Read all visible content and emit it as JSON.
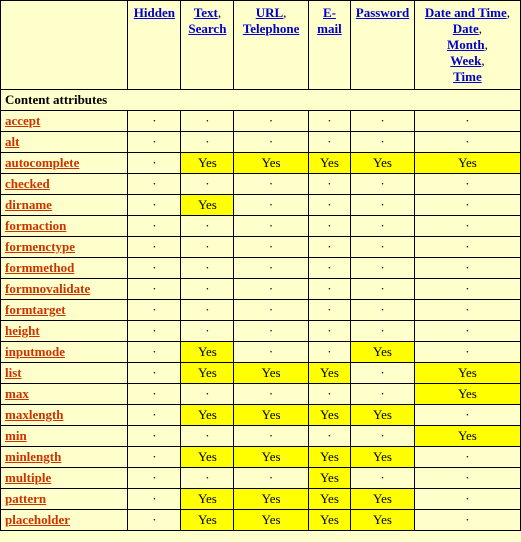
{
  "headers": {
    "hidden": [
      "Hidden"
    ],
    "text": [
      "Text",
      "Search"
    ],
    "url": [
      "URL",
      "Telephone"
    ],
    "email": [
      "E-mail"
    ],
    "password": [
      "Password"
    ],
    "date": [
      "Date and Time",
      "Date",
      "Month",
      "Week",
      "Time"
    ]
  },
  "section": "Content attributes",
  "yes": "Yes",
  "dot": "·",
  "rows": [
    {
      "attr": "accept",
      "cells": [
        "dot",
        "dot",
        "dot",
        "dot",
        "dot",
        "dot"
      ]
    },
    {
      "attr": "alt",
      "cells": [
        "dot",
        "dot",
        "dot",
        "dot",
        "dot",
        "dot"
      ]
    },
    {
      "attr": "autocomplete",
      "cells": [
        "dot",
        "yes",
        "yes",
        "yes",
        "yes",
        "yes"
      ]
    },
    {
      "attr": "checked",
      "cells": [
        "dot",
        "dot",
        "dot",
        "dot",
        "dot",
        "dot"
      ]
    },
    {
      "attr": "dirname",
      "cells": [
        "dot",
        "yes",
        "dot",
        "dot",
        "dot",
        "dot"
      ]
    },
    {
      "attr": "formaction",
      "cells": [
        "dot",
        "dot",
        "dot",
        "dot",
        "dot",
        "dot"
      ]
    },
    {
      "attr": "formenctype",
      "cells": [
        "dot",
        "dot",
        "dot",
        "dot",
        "dot",
        "dot"
      ]
    },
    {
      "attr": "formmethod",
      "cells": [
        "dot",
        "dot",
        "dot",
        "dot",
        "dot",
        "dot"
      ]
    },
    {
      "attr": "formnovalidate",
      "cells": [
        "dot",
        "dot",
        "dot",
        "dot",
        "dot",
        "dot"
      ]
    },
    {
      "attr": "formtarget",
      "cells": [
        "dot",
        "dot",
        "dot",
        "dot",
        "dot",
        "dot"
      ]
    },
    {
      "attr": "height",
      "cells": [
        "dot",
        "dot",
        "dot",
        "dot",
        "dot",
        "dot"
      ]
    },
    {
      "attr": "inputmode",
      "cells": [
        "dot",
        "yes",
        "dot",
        "dot",
        "yes",
        "dot"
      ]
    },
    {
      "attr": "list",
      "cells": [
        "dot",
        "yes",
        "yes",
        "yes",
        "dot",
        "yes"
      ]
    },
    {
      "attr": "max",
      "cells": [
        "dot",
        "dot",
        "dot",
        "dot",
        "dot",
        "yes"
      ]
    },
    {
      "attr": "maxlength",
      "cells": [
        "dot",
        "yes",
        "yes",
        "yes",
        "yes",
        "dot"
      ]
    },
    {
      "attr": "min",
      "cells": [
        "dot",
        "dot",
        "dot",
        "dot",
        "dot",
        "yes"
      ]
    },
    {
      "attr": "minlength",
      "cells": [
        "dot",
        "yes",
        "yes",
        "yes",
        "yes",
        "dot"
      ]
    },
    {
      "attr": "multiple",
      "cells": [
        "dot",
        "dot",
        "dot",
        "yes",
        "dot",
        "dot"
      ]
    },
    {
      "attr": "pattern",
      "cells": [
        "dot",
        "yes",
        "yes",
        "yes",
        "yes",
        "dot"
      ]
    },
    {
      "attr": "placeholder",
      "cells": [
        "dot",
        "yes",
        "yes",
        "yes",
        "yes",
        "dot"
      ]
    }
  ]
}
